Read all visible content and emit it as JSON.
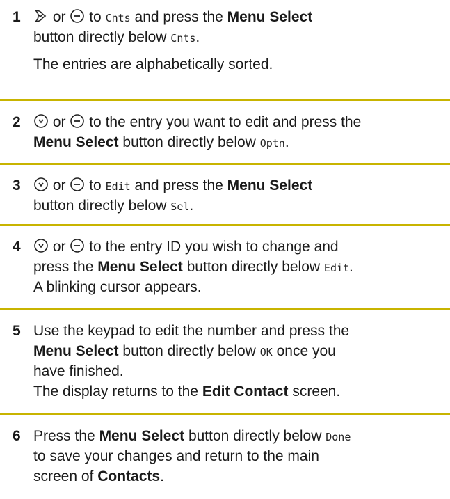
{
  "steps": [
    {
      "num": "1",
      "line1": {
        "or": "or",
        "to": "to",
        "code1": "Cnts",
        "mid": "and press the",
        "bold": "Menu Select"
      },
      "line2": {
        "pre": "button directly below",
        "code": "Cnts",
        "post": "."
      },
      "note": "The entries are alphabetically sorted."
    },
    {
      "num": "2",
      "line1": {
        "or": "or",
        "text": "to the entry you want to edit and press the"
      },
      "line2": {
        "bold": "Menu Select",
        "pre": "button directly below",
        "code": "Optn",
        "post": "."
      }
    },
    {
      "num": "3",
      "line1": {
        "or": "or",
        "to": "to",
        "code1": "Edit",
        "mid": "and press the",
        "bold": "Menu Select"
      },
      "line2": {
        "pre": "button directly below",
        "code": "Sel",
        "post": "."
      }
    },
    {
      "num": "4",
      "line1": {
        "or": "or",
        "text": "to the entry ID you wish to change and"
      },
      "line2": {
        "pre": "press the",
        "bold": "Menu Select",
        "mid": "button directly below",
        "code": "Edit",
        "post": "."
      },
      "line3": "A blinking cursor appears."
    },
    {
      "num": "5",
      "line1": "Use the keypad to edit the number and press the",
      "line2": {
        "bold": "Menu Select",
        "pre": "button directly below",
        "code": "OK",
        "post": "once you"
      },
      "line3": "have finished.",
      "line4": {
        "pre": "The display returns to the",
        "bold": "Edit Contact",
        "post": "screen."
      }
    },
    {
      "num": "6",
      "line1": {
        "pre": "Press the",
        "bold": "Menu Select",
        "mid": "button directly below",
        "code": "Done"
      },
      "line2": "to save your changes and return to the main",
      "line3": {
        "pre": "screen of",
        "bold": "Contacts",
        "post": "."
      }
    }
  ],
  "icons": {
    "down": "scroll-down-icon",
    "up": "scroll-up-icon"
  },
  "colors": {
    "separator": "#c8b400",
    "text": "#1a1a1a"
  }
}
